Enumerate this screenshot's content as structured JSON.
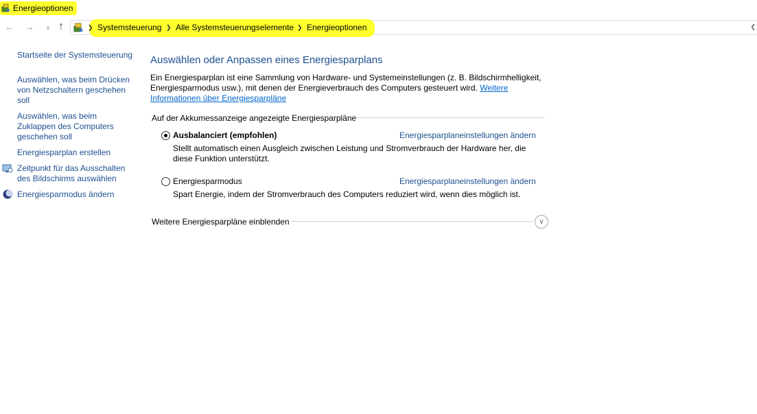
{
  "window": {
    "title": "Energieoptionen",
    "title_icon": "power-options-icon"
  },
  "address_bar": {
    "icon": "control-panel-icon",
    "breadcrumbs": [
      "Systemsteuerung",
      "Alle Systemsteuerungselemente",
      "Energieoptionen"
    ]
  },
  "sidebar": {
    "items": [
      {
        "label": "Startseite der Systemsteuerung"
      },
      {
        "label": "Auswählen, was beim Drücken von Netzschaltern geschehen soll"
      },
      {
        "label": "Auswählen, was beim Zuklappen des Computers geschehen soll"
      },
      {
        "label": "Energiesparplan erstellen"
      },
      {
        "label": "Zeitpunkt für das Ausschalten des Bildschirms auswählen",
        "icon": "display-icon"
      },
      {
        "label": "Energiesparmodus ändern",
        "icon": "moon-icon"
      }
    ]
  },
  "main": {
    "title": "Auswählen oder Anpassen eines Energiesparplans",
    "intro_text": "Ein Energiesparplan ist eine Sammlung von Hardware- und Systemeinstellungen (z. B. Bildschirmhelligkeit, Energiesparmodus usw.), mit denen der Energieverbrauch des Computers gesteuert wird. ",
    "intro_link": "Weitere Informationen über Energiesparpläne",
    "section_label": "Auf der Akkumessanzeige angezeigte Energiesparpläne",
    "plans": [
      {
        "name": "Ausbalanciert (empfohlen)",
        "selected": true,
        "link": "Energiesparplaneinstellungen ändern",
        "description": "Stellt automatisch einen Ausgleich zwischen Leistung und Stromverbrauch der Hardware her, die diese Funktion unterstützt."
      },
      {
        "name": "Energiesparmodus",
        "selected": false,
        "link": "Energiesparplaneinstellungen ändern",
        "description": "Spart Energie, indem der Stromverbrauch des Computers reduziert wird, wenn dies möglich ist."
      }
    ],
    "more_plans_label": "Weitere Energiesparpläne einblenden"
  },
  "colors": {
    "highlight": "#ffff2e",
    "link": "#1d4f8f",
    "hyperlink": "#0066cc"
  }
}
